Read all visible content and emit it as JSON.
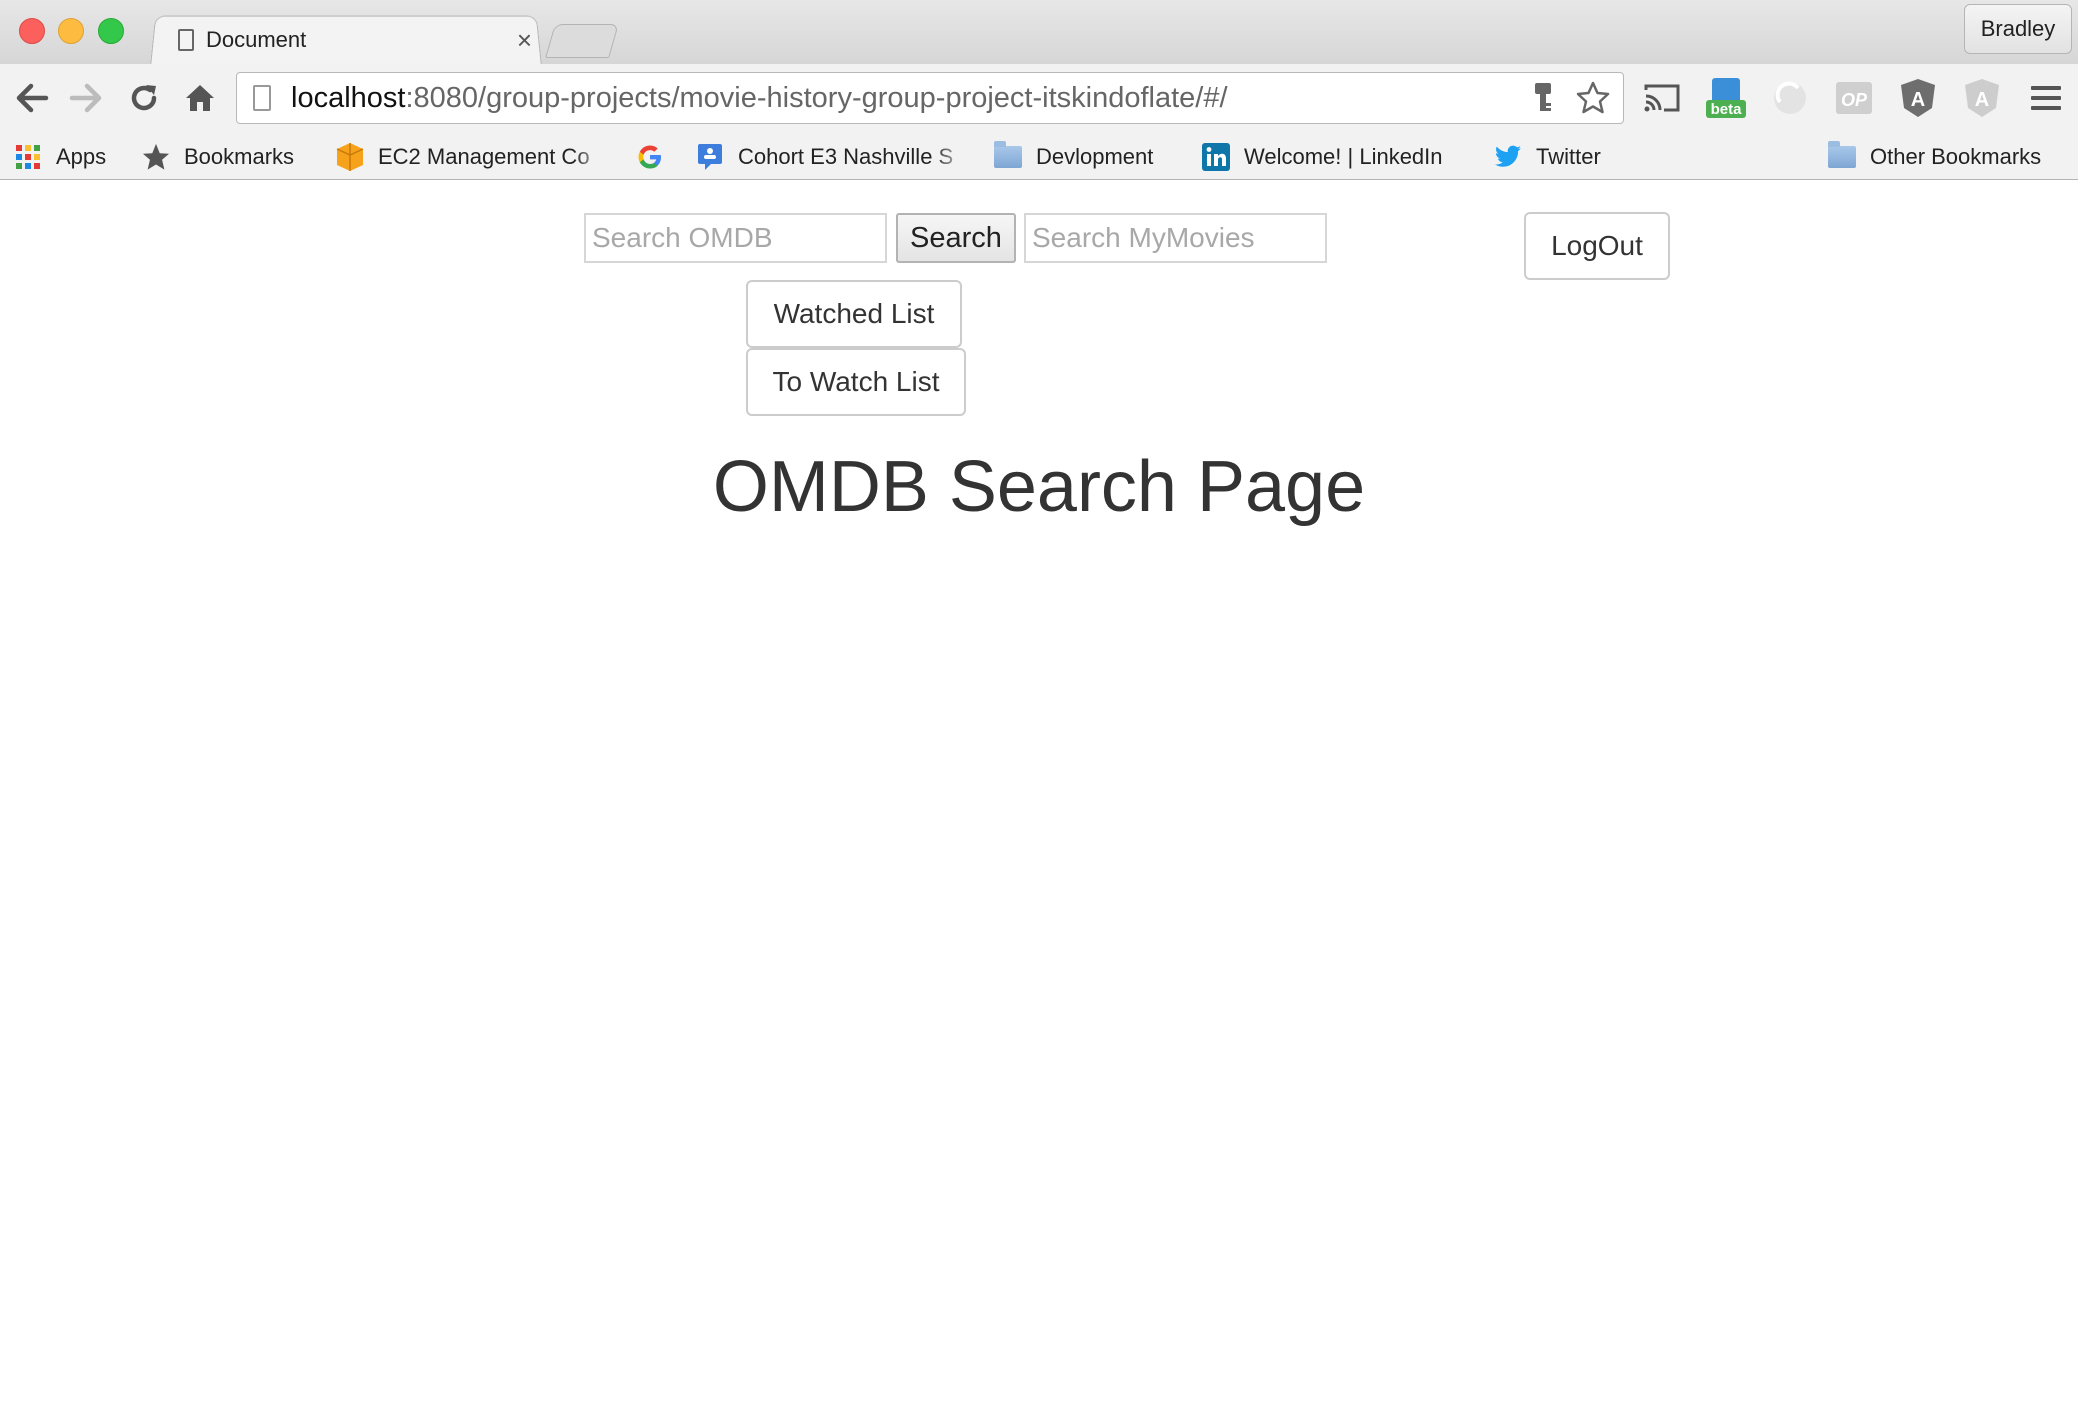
{
  "window": {
    "profile_name": "Bradley"
  },
  "tab": {
    "title": "Document",
    "close_glyph": "×"
  },
  "toolbar": {
    "url_host": "localhost",
    "url_rest": ":8080/group-projects/movie-history-group-project-itskindoflate/#/",
    "extensions": [
      "cast-icon",
      "beta-extension-icon",
      "sync-extension-icon",
      "op-extension-icon",
      "angular-icon",
      "angular-light-icon"
    ],
    "beta_label": "beta",
    "op_label": "OP",
    "angular_label": "A"
  },
  "bookmarks": {
    "items": [
      {
        "label": "Apps",
        "icon": "apps-grid-icon"
      },
      {
        "label": "Bookmarks",
        "icon": "star-icon"
      },
      {
        "label": "EC2 Management Co",
        "icon": "aws-icon"
      },
      {
        "label": "",
        "icon": "google-icon"
      },
      {
        "label": "Cohort E3 Nashville S",
        "icon": "classroom-icon"
      },
      {
        "label": "Devlopment",
        "icon": "folder-icon"
      },
      {
        "label": "Welcome! | LinkedIn",
        "icon": "linkedin-icon"
      },
      {
        "label": "Twitter",
        "icon": "twitter-icon"
      }
    ],
    "other": "Other Bookmarks"
  },
  "page": {
    "search_omdb_placeholder": "Search OMDB",
    "search_button": "Search",
    "search_mymovies_placeholder": "Search MyMovies",
    "logout_button": "LogOut",
    "watched_list_button": "Watched List",
    "to_watch_list_button": "To Watch List",
    "title": "OMDB Search Page"
  }
}
